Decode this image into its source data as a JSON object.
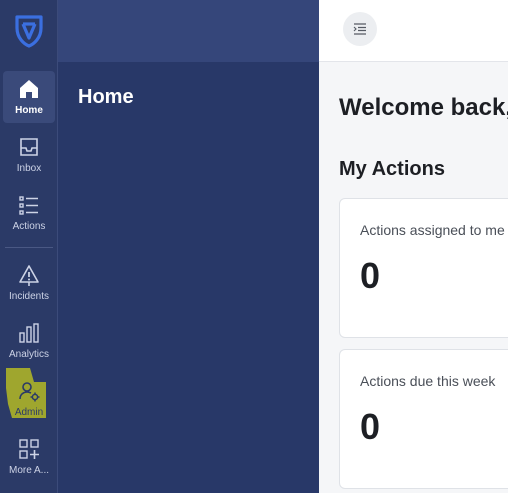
{
  "rail": {
    "items": [
      {
        "label": "Home",
        "icon": "home-icon",
        "active": true
      },
      {
        "label": "Inbox",
        "icon": "inbox-icon"
      },
      {
        "label": "Actions",
        "icon": "list-icon"
      },
      {
        "label": "Incidents",
        "icon": "warning-icon"
      },
      {
        "label": "Analytics",
        "icon": "bar-chart-icon"
      },
      {
        "label": "Admin",
        "icon": "user-gear-icon"
      },
      {
        "label": "More A...",
        "icon": "grid-plus-icon"
      }
    ]
  },
  "sidebar": {
    "title": "Home"
  },
  "main": {
    "welcome": "Welcome back,",
    "section_title": "My Actions",
    "cards": [
      {
        "label": "Actions assigned to me",
        "value": "0"
      },
      {
        "label": "Actions due this week",
        "value": "0"
      }
    ]
  },
  "colors": {
    "rail_bg": "#2b3a67",
    "sidebar_bg": "#283868",
    "logo": "#3b6fe0",
    "admin_highlight": "#ffff00"
  }
}
